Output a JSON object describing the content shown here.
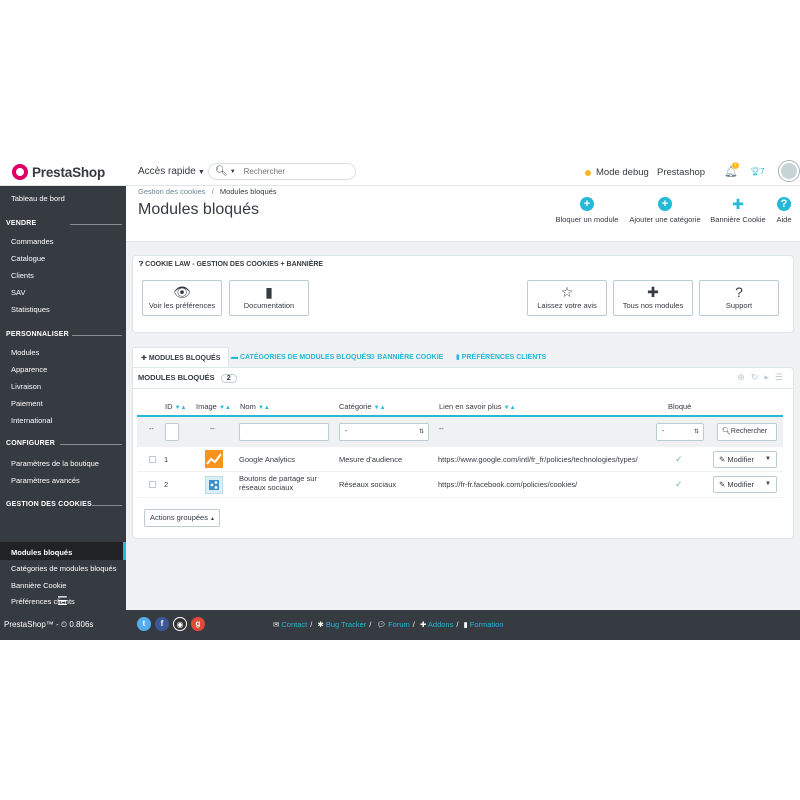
{
  "header": {
    "brand": "PrestaShop",
    "quick_access": "Accès rapide",
    "search_placeholder": "Rechercher",
    "debug_mode": "Mode debug",
    "shop_name": "Prestashop",
    "notif_count": "7",
    "trophy_count": "7"
  },
  "sidebar": {
    "dashboard": "Tableau de bord",
    "sections": [
      {
        "title": "VENDRE",
        "items": [
          "Commandes",
          "Catalogue",
          "Clients",
          "SAV",
          "Statistiques"
        ]
      },
      {
        "title": "PERSONNALISER",
        "items": [
          "Modules",
          "Apparence",
          "Livraison",
          "Paiement",
          "International"
        ]
      },
      {
        "title": "CONFIGURER",
        "items": [
          "Paramètres de la boutique",
          "Paramètres avancés"
        ]
      },
      {
        "title": "GESTION DES COOKIES",
        "items": [
          "Modules bloqués",
          "Catégories de modules bloqués",
          "Bannière Cookie",
          "Préférences clients"
        ]
      }
    ]
  },
  "toolbar": {
    "breadcrumb_parent": "Gestion des cookies",
    "breadcrumb_sep": "/",
    "breadcrumb_current": "Modules bloqués",
    "title": "Modules bloqués",
    "buttons": [
      "Bloquer un module",
      "Ajouter une catégorie",
      "Bannière Cookie",
      "Aide"
    ]
  },
  "info_panel": {
    "heading": "COOKIE LAW - GESTION DES COOKIES + BANNIÈRE",
    "buttons": [
      "Voir les préférences",
      "Documentation",
      "Laissez votre avis",
      "Tous nos modules",
      "Support"
    ]
  },
  "tabs": [
    "MODULES BLOQUÉS",
    "CATÉGORIES DE MODULES BLOQUÉS",
    "BANNIÈRE COOKIE",
    "PRÉFÉRENCES CLIENTS"
  ],
  "list": {
    "title": "MODULES BLOQUÉS",
    "count": "2",
    "columns": {
      "id": "ID",
      "image": "Image",
      "name": "Nom",
      "category": "Catégorie",
      "link": "Lien en savoir plus",
      "blocked": "Bloqué"
    },
    "filter": {
      "dash": "--",
      "select_default": "-",
      "search_button": "Rechercher"
    },
    "rows": [
      {
        "id": "1",
        "name": "Google Analytics",
        "category": "Mesure d'audience",
        "link": "https://www.google.com/intl/fr_fr/policies/technologies/types/",
        "action": "Modifier"
      },
      {
        "id": "2",
        "name": "Boutons de partage sur réseaux sociaux",
        "category": "Réseaux sociaux",
        "link": "https://fr-fr.facebook.com/policies/cookies/",
        "action": "Modifier"
      }
    ],
    "bulk_actions": "Actions groupées"
  },
  "footer": {
    "version": "PrestaShop™ - ⏲ 0.806s",
    "links": [
      "Contact",
      "Bug Tracker",
      "Forum",
      "Addons",
      "Formation"
    ]
  },
  "colors": {
    "accent": "#25b9d7",
    "sidebar": "#363a41",
    "brand": "#df0067",
    "success": "#72c279"
  }
}
